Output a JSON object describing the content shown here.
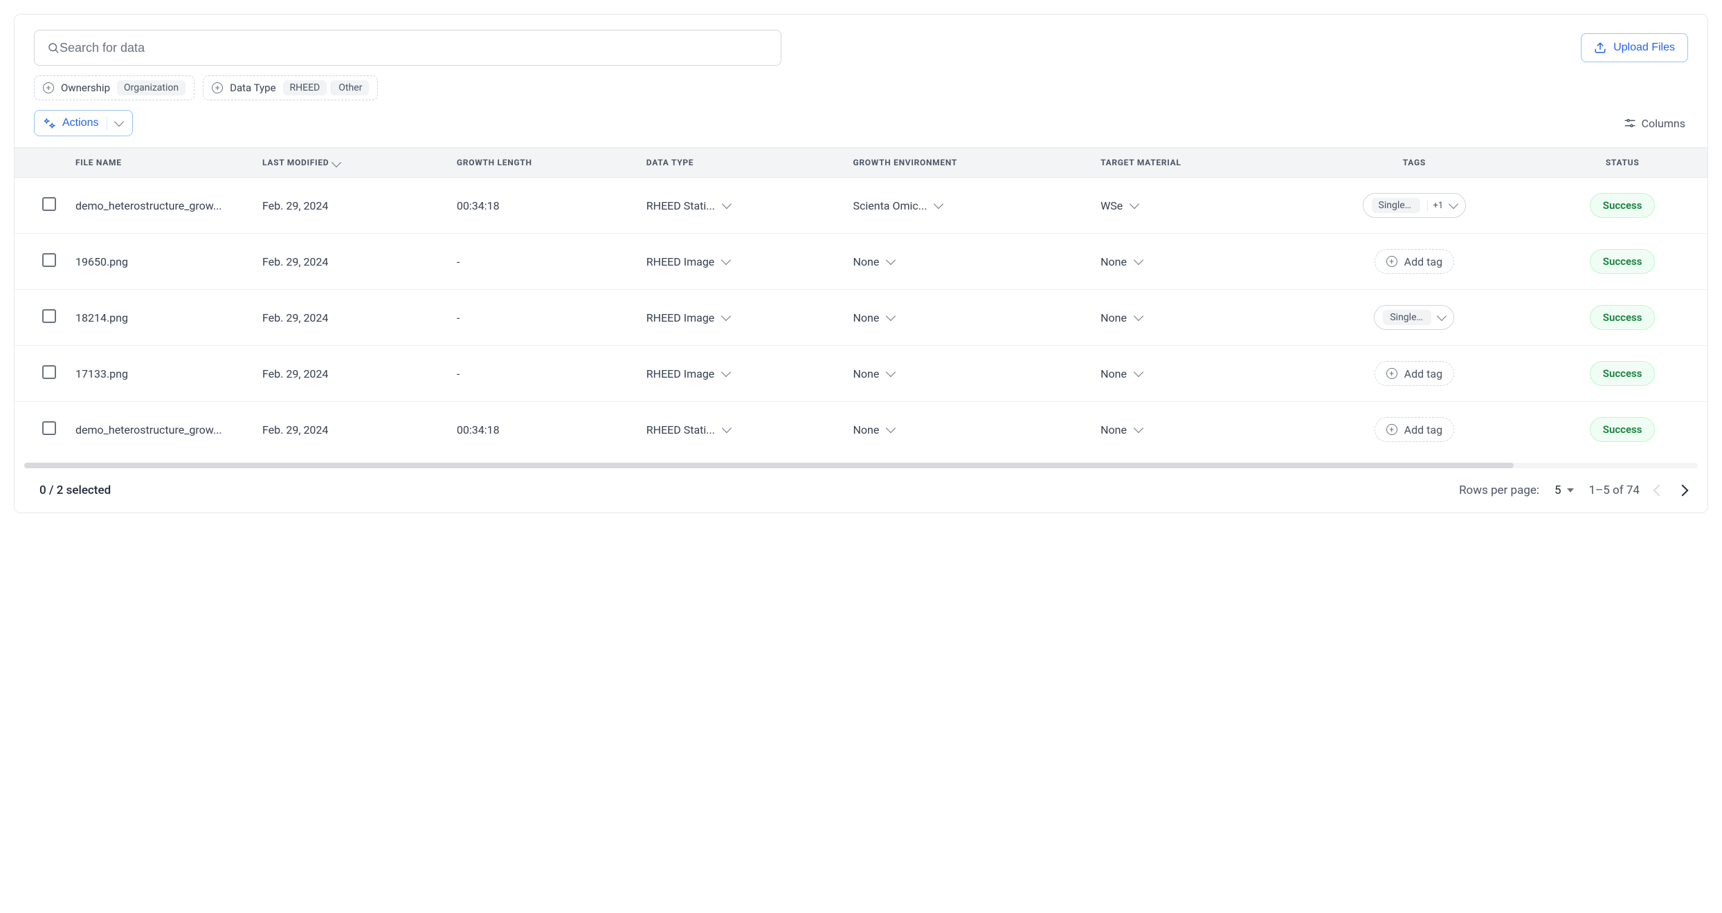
{
  "search": {
    "placeholder": "Search for data"
  },
  "upload": {
    "label": "Upload Files"
  },
  "filters": {
    "ownership_label": "Ownership",
    "ownership_chips": [
      "Organization"
    ],
    "data_type_label": "Data Type",
    "data_type_chips": [
      "RHEED",
      "Other"
    ]
  },
  "actions_label": "Actions",
  "columns_label": "Columns",
  "columns": {
    "file_name": "FILE NAME",
    "last_modified": "LAST MODIFIED",
    "growth_length": "GROWTH LENGTH",
    "data_type": "DATA TYPE",
    "growth_environment": "GROWTH ENVIRONMENT",
    "target_material": "TARGET MATERIAL",
    "tags": "TAGS",
    "status": "STATUS"
  },
  "add_tag_label": "Add tag",
  "rows": [
    {
      "file_name": "demo_heterostructure_grow...",
      "last_modified": "Feb. 29, 2024",
      "growth_length": "00:34:18",
      "data_type": "RHEED Stati...",
      "growth_environment": "Scienta Omic...",
      "target_material": "WSe",
      "tag_primary": "Single ...",
      "tag_extra": "+1",
      "status": "Success"
    },
    {
      "file_name": "19650.png",
      "last_modified": "Feb. 29, 2024",
      "growth_length": "-",
      "data_type": "RHEED Image",
      "growth_environment": "None",
      "target_material": "None",
      "tag_primary": null,
      "tag_extra": null,
      "status": "Success"
    },
    {
      "file_name": "18214.png",
      "last_modified": "Feb. 29, 2024",
      "growth_length": "-",
      "data_type": "RHEED Image",
      "growth_environment": "None",
      "target_material": "None",
      "tag_primary": "Single ...",
      "tag_extra": null,
      "status": "Success"
    },
    {
      "file_name": "17133.png",
      "last_modified": "Feb. 29, 2024",
      "growth_length": "-",
      "data_type": "RHEED Image",
      "growth_environment": "None",
      "target_material": "None",
      "tag_primary": null,
      "tag_extra": null,
      "status": "Success"
    },
    {
      "file_name": "demo_heterostructure_grow...",
      "last_modified": "Feb. 29, 2024",
      "growth_length": "00:34:18",
      "data_type": "RHEED Stati...",
      "growth_environment": "None",
      "target_material": "None",
      "tag_primary": null,
      "tag_extra": null,
      "status": "Success"
    }
  ],
  "footer": {
    "selection": "0 / 2 selected",
    "rows_per_page_label": "Rows per page:",
    "rows_per_page_value": "5",
    "range": "1–5 of 74"
  }
}
